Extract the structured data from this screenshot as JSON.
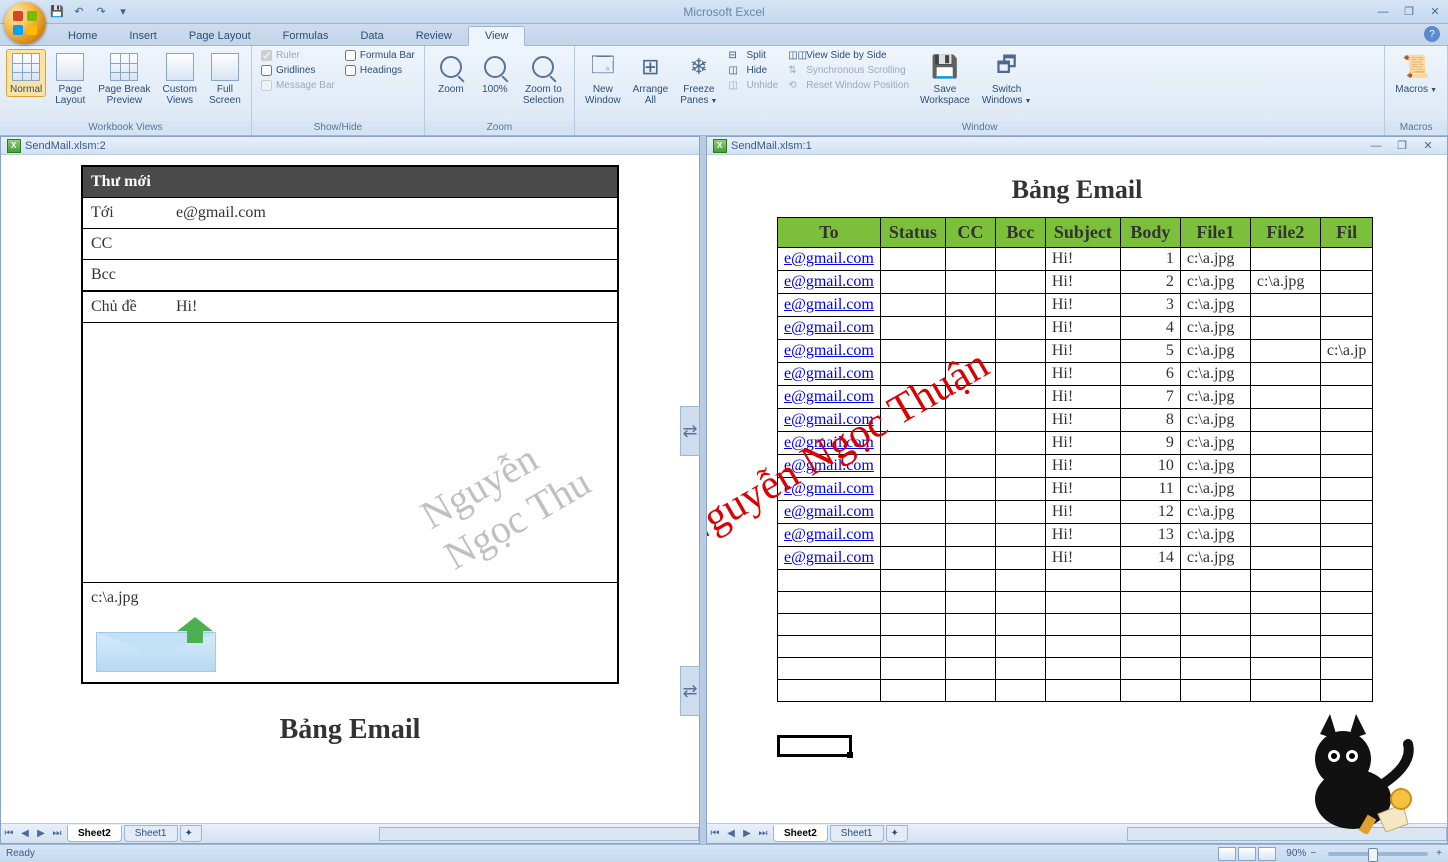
{
  "app_title": "Microsoft Excel",
  "qa": {
    "save": "Save",
    "undo": "Undo",
    "redo": "Redo"
  },
  "tabs": [
    "Home",
    "Insert",
    "Page Layout",
    "Formulas",
    "Data",
    "Review",
    "View"
  ],
  "active_tab": "View",
  "ribbon": {
    "workbook_views": {
      "label": "Workbook Views",
      "normal": "Normal",
      "page_layout": "Page\nLayout",
      "page_break": "Page Break\nPreview",
      "custom": "Custom\nViews",
      "full": "Full\nScreen"
    },
    "show_hide": {
      "label": "Show/Hide",
      "ruler": "Ruler",
      "gridlines": "Gridlines",
      "message_bar": "Message Bar",
      "formula_bar": "Formula Bar",
      "headings": "Headings"
    },
    "zoom": {
      "label": "Zoom",
      "zoom": "Zoom",
      "hundred": "100%",
      "to_sel": "Zoom to\nSelection"
    },
    "window": {
      "label": "Window",
      "new_window": "New\nWindow",
      "arrange": "Arrange\nAll",
      "freeze": "Freeze\nPanes",
      "split": "Split",
      "hide": "Hide",
      "unhide": "Unhide",
      "side": "View Side by Side",
      "sync": "Synchronous Scrolling",
      "reset": "Reset Window Position",
      "save_ws": "Save\nWorkspace",
      "switch": "Switch\nWindows"
    },
    "macros": {
      "label": "Macros",
      "macros": "Macros"
    }
  },
  "panes": {
    "left_title": "SendMail.xlsm:2",
    "right_title": "SendMail.xlsm:1"
  },
  "sheets": {
    "s1": "Sheet2",
    "s2": "Sheet1"
  },
  "email_form": {
    "header": "Thư mới",
    "to_lbl": "Tới",
    "to_val": "e@gmail.com",
    "cc_lbl": "CC",
    "bcc_lbl": "Bcc",
    "subj_lbl": "Chủ đề",
    "subj_val": "Hi!",
    "attach": "c:\\a.jpg"
  },
  "left_heading": "Bảng Email",
  "right_heading": "Bảng Email",
  "table": {
    "headers": [
      "To",
      "Status",
      "CC",
      "Bcc",
      "Subject",
      "Body",
      "File1",
      "File2",
      "Fil"
    ],
    "rows": [
      {
        "to": "e@gmail.com",
        "subject": "Hi!",
        "body": "1",
        "file1": "c:\\a.jpg",
        "file2": "",
        "file3": ""
      },
      {
        "to": "e@gmail.com",
        "subject": "Hi!",
        "body": "2",
        "file1": "c:\\a.jpg",
        "file2": "c:\\a.jpg",
        "file3": ""
      },
      {
        "to": "e@gmail.com",
        "subject": "Hi!",
        "body": "3",
        "file1": "c:\\a.jpg",
        "file2": "",
        "file3": ""
      },
      {
        "to": "e@gmail.com",
        "subject": "Hi!",
        "body": "4",
        "file1": "c:\\a.jpg",
        "file2": "",
        "file3": ""
      },
      {
        "to": "e@gmail.com",
        "subject": "Hi!",
        "body": "5",
        "file1": "c:\\a.jpg",
        "file2": "",
        "file3": "c:\\a.jp"
      },
      {
        "to": "e@gmail.com",
        "subject": "Hi!",
        "body": "6",
        "file1": "c:\\a.jpg",
        "file2": "",
        "file3": ""
      },
      {
        "to": "e@gmail.com",
        "subject": "Hi!",
        "body": "7",
        "file1": "c:\\a.jpg",
        "file2": "",
        "file3": ""
      },
      {
        "to": "e@gmail.com",
        "subject": "Hi!",
        "body": "8",
        "file1": "c:\\a.jpg",
        "file2": "",
        "file3": ""
      },
      {
        "to": "e@gmail.com",
        "subject": "Hi!",
        "body": "9",
        "file1": "c:\\a.jpg",
        "file2": "",
        "file3": ""
      },
      {
        "to": "e@gmail.com",
        "subject": "Hi!",
        "body": "10",
        "file1": "c:\\a.jpg",
        "file2": "",
        "file3": ""
      },
      {
        "to": "e@gmail.com",
        "subject": "Hi!",
        "body": "11",
        "file1": "c:\\a.jpg",
        "file2": "",
        "file3": ""
      },
      {
        "to": "e@gmail.com",
        "subject": "Hi!",
        "body": "12",
        "file1": "c:\\a.jpg",
        "file2": "",
        "file3": ""
      },
      {
        "to": "e@gmail.com",
        "subject": "Hi!",
        "body": "13",
        "file1": "c:\\a.jpg",
        "file2": "",
        "file3": ""
      },
      {
        "to": "e@gmail.com",
        "subject": "Hi!",
        "body": "14",
        "file1": "c:\\a.jpg",
        "file2": "",
        "file3": ""
      }
    ],
    "empty_rows": 6
  },
  "watermark": "Nguyễn Ngọc Thu",
  "status": {
    "ready": "Ready",
    "zoom": "90%"
  }
}
